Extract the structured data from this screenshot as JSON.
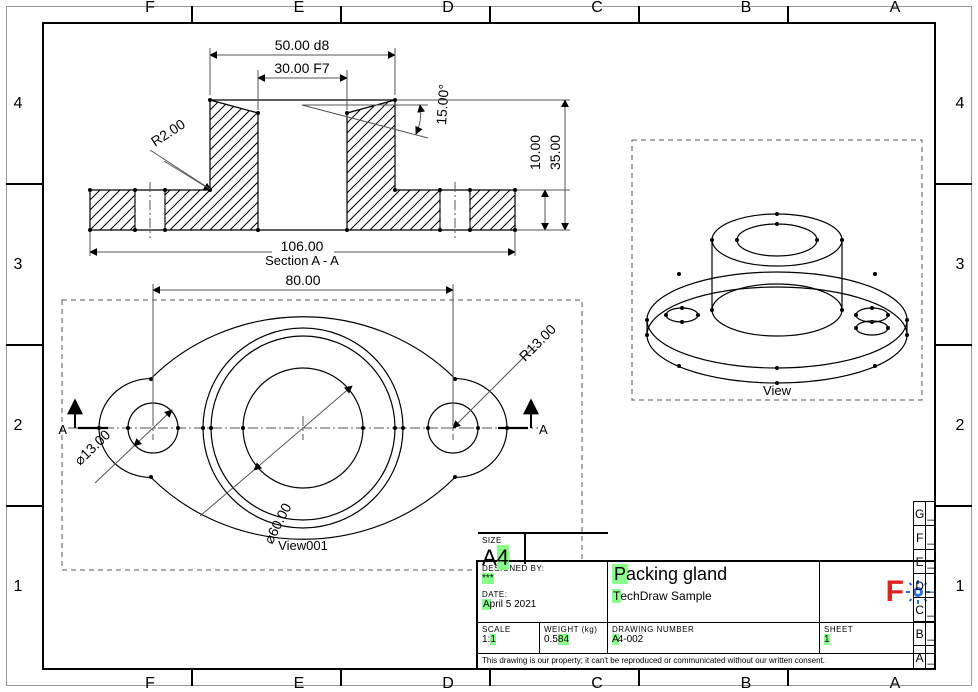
{
  "zonesH": [
    "4",
    "3",
    "2",
    "1"
  ],
  "zonesV": [
    "F",
    "E",
    "D",
    "C",
    "B",
    "A"
  ],
  "section": {
    "label": "Section A - A",
    "dims": {
      "d50": "50.00 d8",
      "d30": "30.00 F7",
      "angle": "15.00°",
      "r2": "R2.00",
      "h10": "10.00",
      "h35": "35.00",
      "w106": "106.00"
    }
  },
  "top_view": {
    "label": "View001",
    "dims": {
      "d80": "80.00",
      "r13": "R13.00",
      "dia60": "⌀60.00",
      "dia13": "⌀13.00",
      "sectA": "A",
      "sectA2": "A"
    }
  },
  "iso": {
    "label": "View"
  },
  "titleblock": {
    "designed_by_lbl": "DESIGNED BY:",
    "designed_by": "***",
    "date_lbl": "DATE:",
    "date": "April 5 2021",
    "size_lbl": "SIZE",
    "size": "A4",
    "title": "Packing gland",
    "subtitle": "TechDraw Sample",
    "scale_lbl": "SCALE",
    "scale": "1:1",
    "weight_lbl": "WEIGHT (kg)",
    "weight": "0.584",
    "dn_lbl": "DRAWING NUMBER",
    "dn": "A4-002",
    "sheet_lbl": "SHEET",
    "sheet": "1",
    "disclaimer": "This drawing is our property; it can't be reproduced or communicated without our written consent.",
    "rev": [
      "G",
      "F",
      "E",
      "D",
      "C",
      "B",
      "A"
    ],
    "rev_mark": "_"
  }
}
